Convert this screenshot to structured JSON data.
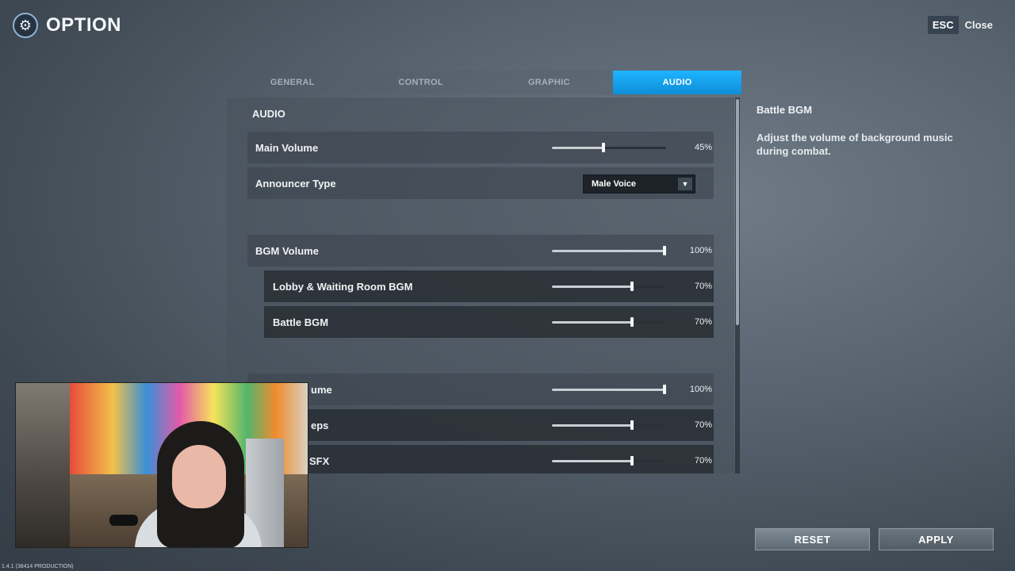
{
  "header": {
    "title": "OPTION",
    "icon": "gear-icon"
  },
  "close": {
    "key": "ESC",
    "label": "Close"
  },
  "tabs": [
    {
      "label": "GENERAL",
      "active": false
    },
    {
      "label": "CONTROL",
      "active": false
    },
    {
      "label": "GRAPHIC",
      "active": false
    },
    {
      "label": "AUDIO",
      "active": true
    }
  ],
  "section_title": "AUDIO",
  "rows": {
    "main_volume": {
      "label": "Main Volume",
      "value": 45,
      "value_text": "45%"
    },
    "announcer_type": {
      "label": "Announcer Type",
      "selected": "Male Voice"
    },
    "bgm_volume": {
      "label": "BGM Volume",
      "value": 100,
      "value_text": "100%"
    },
    "lobby_bgm": {
      "label": "Lobby & Waiting Room BGM",
      "value": 70,
      "value_text": "70%"
    },
    "battle_bgm": {
      "label": "Battle BGM",
      "value": 70,
      "value_text": "70%"
    },
    "sfx_volume": {
      "label": "ume",
      "value": 100,
      "value_text": "100%"
    },
    "footsteps": {
      "label": "eps",
      "value": 70,
      "value_text": "70%"
    },
    "sfx": {
      "label": "SFX",
      "value": 70,
      "value_text": "70%"
    }
  },
  "description": {
    "title": "Battle BGM",
    "text": "Adjust the volume of background music during combat."
  },
  "buttons": {
    "reset": "RESET",
    "apply": "APPLY"
  },
  "version": "1.4.1 (38414 PRODUCTION)",
  "colors": {
    "accent": "#1fb4ff"
  }
}
